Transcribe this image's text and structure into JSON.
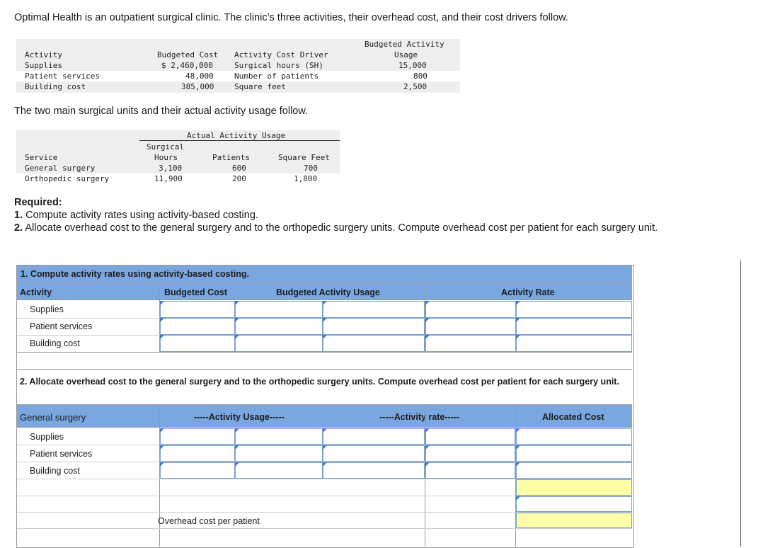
{
  "intro": "Optimal Health is an outpatient surgical clinic. The clinic’s three activities, their overhead cost, and their cost drivers follow.",
  "table1": {
    "headers": {
      "activity": "Activity",
      "budgeted_cost": "Budgeted Cost",
      "driver": "Activity Cost Driver",
      "usage_line1": "Budgeted Activity",
      "usage_line2": "Usage"
    },
    "rows": [
      {
        "activity": "Supplies",
        "cost": "$ 2,460,000",
        "driver": "Surgical hours (SH)",
        "usage": "15,000"
      },
      {
        "activity": "Patient services",
        "cost": "48,000",
        "driver": "Number of patients",
        "usage": "800"
      },
      {
        "activity": "Building cost",
        "cost": "385,000",
        "driver": "Square feet",
        "usage": "2,500"
      }
    ]
  },
  "follow_text": "The two main surgical units and their actual activity usage follow.",
  "table2": {
    "group_header": "Actual Activity Usage",
    "headers": {
      "service": "Service",
      "surgical_line1": "Surgical",
      "surgical_line2": "Hours",
      "patients": "Patients",
      "sqft": "Square Feet"
    },
    "rows": [
      {
        "service": "General surgery",
        "hours": "3,100",
        "patients": "600",
        "sqft": "700"
      },
      {
        "service": "Orthopedic surgery",
        "hours": "11,900",
        "patients": "200",
        "sqft": "1,800"
      }
    ]
  },
  "required": {
    "title": "Required:",
    "item1_num": "1.",
    "item1": "Compute activity rates using activity-based costing.",
    "item2_num": "2.",
    "item2": "Allocate overhead cost to the general surgery and to the orthopedic surgery units. Compute overhead cost per patient for each surgery unit."
  },
  "answer": {
    "part1_title": "1. Compute activity rates using activity-based costing.",
    "part1_headers": {
      "activity": "Activity",
      "budgeted_cost": "Budgeted Cost",
      "usage": "Budgeted Activity Usage",
      "rate": "Activity Rate"
    },
    "part1_rows": [
      "Supplies",
      "Patient services",
      "Building cost"
    ],
    "part2_title": "2. Allocate overhead cost to the general surgery and to the orthopedic surgery units. Compute overhead cost per patient for each surgery unit.",
    "part2_headers": {
      "unit": "General surgery",
      "usage": "-----Activity Usage-----",
      "rate": "-----Activity rate-----",
      "allocated": "Allocated Cost"
    },
    "part2_rows": [
      "Supplies",
      "Patient services",
      "Building cost"
    ],
    "overhead_label": "Overhead cost per patient"
  }
}
